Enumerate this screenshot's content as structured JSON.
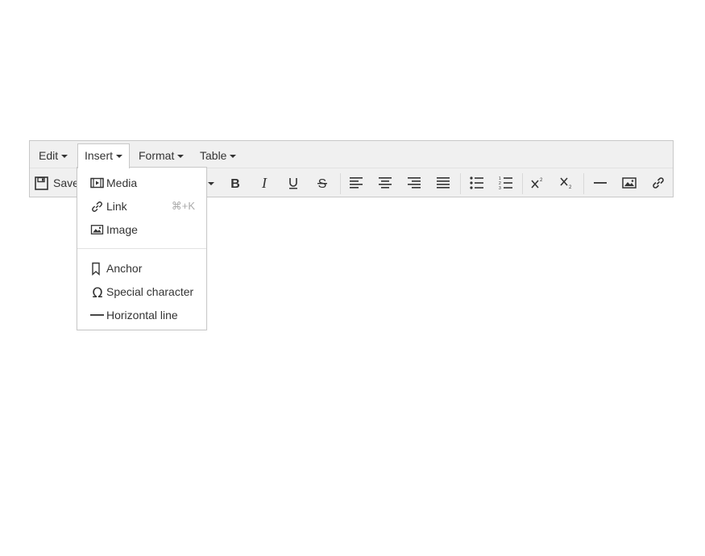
{
  "menubar": {
    "items": [
      {
        "label": "Edit"
      },
      {
        "label": "Insert"
      },
      {
        "label": "Format"
      },
      {
        "label": "Table"
      }
    ]
  },
  "toolbar": {
    "save_label": "Save",
    "buttons": [
      "bold-icon",
      "italic-icon",
      "underline-icon",
      "strikethrough-icon",
      "align-left-icon",
      "align-center-icon",
      "align-right-icon",
      "align-justify-icon",
      "bullet-list-icon",
      "numbered-list-icon",
      "superscript-icon",
      "subscript-icon",
      "horizontal-line-icon",
      "image-icon",
      "link-icon"
    ]
  },
  "insert_menu": {
    "items": [
      {
        "label": "Media",
        "icon": "media-icon",
        "shortcut": ""
      },
      {
        "label": "Link",
        "icon": "link-icon",
        "shortcut": "⌘+K"
      },
      {
        "label": "Image",
        "icon": "image-icon",
        "shortcut": ""
      },
      {
        "label": "Anchor",
        "icon": "bookmark-icon",
        "shortcut": ""
      },
      {
        "label": "Special character",
        "icon": "omega-icon",
        "shortcut": ""
      },
      {
        "label": "Horizontal line",
        "icon": "horizontal-line-icon",
        "shortcut": ""
      }
    ]
  },
  "colors": {
    "toolbar_bg": "#f0f0f0",
    "border": "#c8c8c8",
    "text": "#333333",
    "shortcut": "#aaaaaa"
  }
}
